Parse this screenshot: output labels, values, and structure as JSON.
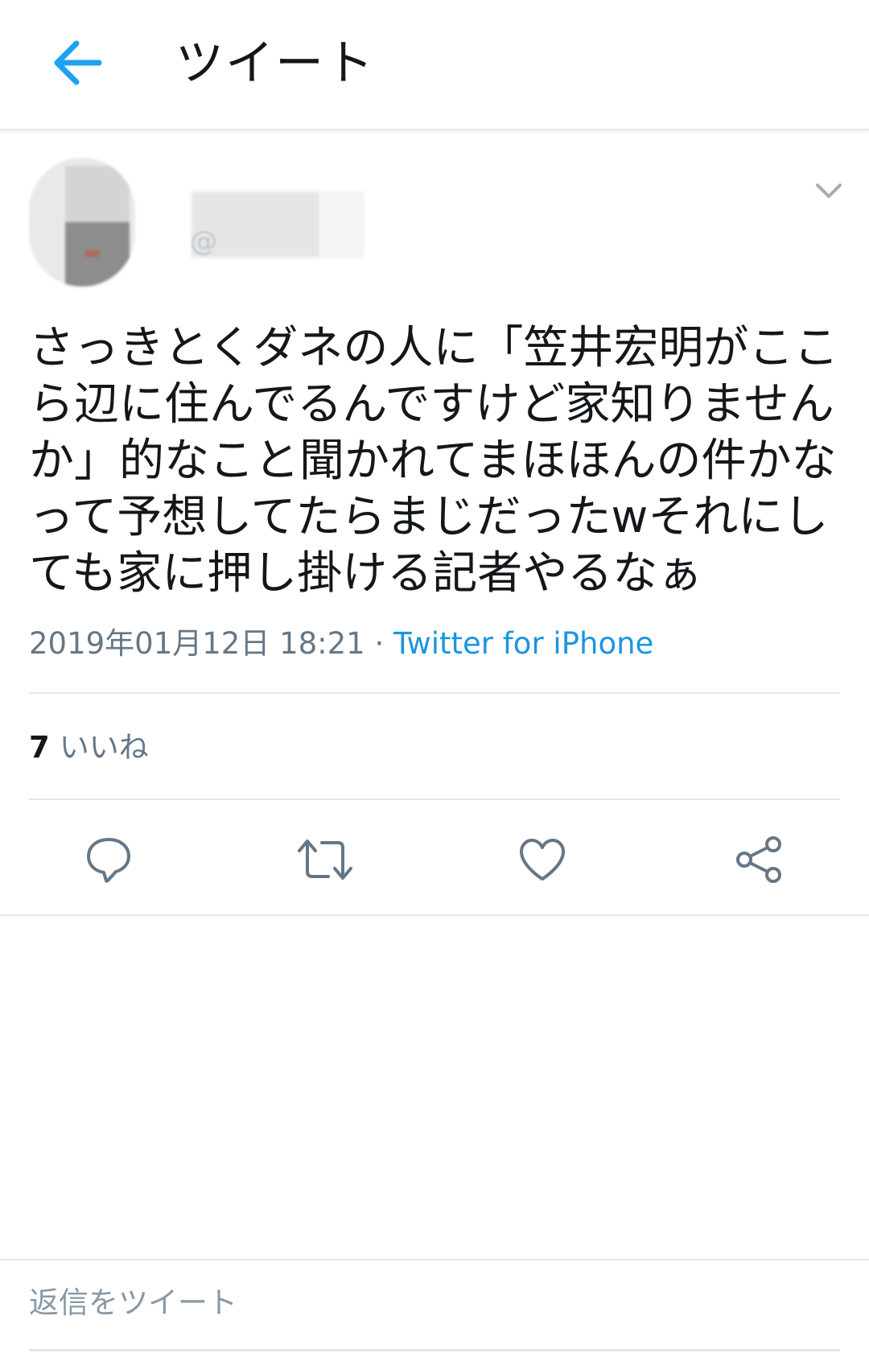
{
  "header": {
    "title": "ツイート",
    "back_icon": "arrow-left-icon",
    "accent_color": "#1da1f2"
  },
  "author": {
    "handle_prefix": "@",
    "menu_icon": "chevron-down-icon"
  },
  "tweet": {
    "text": "さっきとくダネの人に「笠井宏明がここ\nら辺に住んでるんですけど家知りません\nか」的なこと聞かれてまほほんの件かな\nって予想してたらまじだったwそれにし\nても家に押し掛ける記者やるなぁ",
    "timestamp": "2019年01月12日 18:21",
    "separator": " · ",
    "client": "Twitter for iPhone",
    "client_color": "#1b95e0"
  },
  "stats": {
    "likes_count": "7",
    "likes_label": "いいね"
  },
  "actions": [
    {
      "name": "reply",
      "icon": "reply-bubble-icon"
    },
    {
      "name": "retweet",
      "icon": "retweet-icon"
    },
    {
      "name": "like",
      "icon": "heart-icon"
    },
    {
      "name": "share",
      "icon": "share-icon"
    }
  ],
  "reply_bar": {
    "placeholder": "返信をツイート"
  }
}
